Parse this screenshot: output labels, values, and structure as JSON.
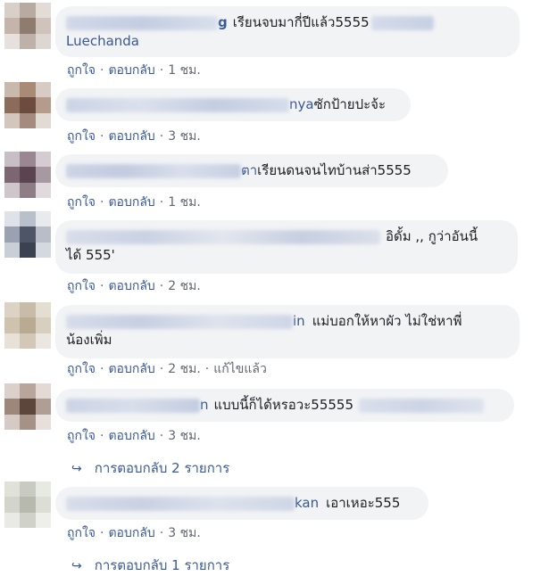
{
  "comments": [
    {
      "name_tail": "g",
      "text_line1": "เรียนจบมากี่ปีแล้ว5555",
      "text_line2": "Luechanda",
      "like": "ถูกใจ",
      "reply": "ตอบกลับ",
      "time": "1 ชม."
    },
    {
      "name_tail": "nya",
      "text": "ซักป้ายปะจ้ะ",
      "like": "ถูกใจ",
      "reply": "ตอบกลับ",
      "time": "3 ชม."
    },
    {
      "name_tail": "ตา",
      "text": "เรียนดนจนไทบ้านส่า5555",
      "like": "ถูกใจ",
      "reply": "ตอบกลับ",
      "time": "1 ชม."
    },
    {
      "text_line1": "อิดั้ม ,, กูว่าอันนี้",
      "text_line2": "ได้ 555'",
      "like": "ถูกใจ",
      "reply": "ตอบกลับ",
      "time": "2 ชม."
    },
    {
      "name_tail": "in",
      "text_line1": "แม่บอกให้หาผัว ไม่ใช่หาพี่",
      "text_line2": "น้องเพิ่ม",
      "like": "ถูกใจ",
      "reply": "ตอบกลับ",
      "time": "2 ชม.",
      "edited": "แก้ไขแล้ว"
    },
    {
      "name_tail": "n",
      "text": "แบบนี้ก็ได้หรอวะ55555",
      "like": "ถูกใจ",
      "reply": "ตอบกลับ",
      "time": "3 ชม.",
      "replies": "การตอบกลับ 2 รายการ"
    },
    {
      "name_tail": "kan",
      "text": "เอาเหอะ555",
      "like": "ถูกใจ",
      "reply": "ตอบกลับ",
      "time": "3 ชม.",
      "replies": "การตอบกลับ 1 รายการ"
    }
  ],
  "colors": {
    "link": "#385898",
    "bubble": "#f2f3f5",
    "meta": "#606770"
  },
  "icons": {
    "reply_arrow": "reply-arrow-icon"
  }
}
